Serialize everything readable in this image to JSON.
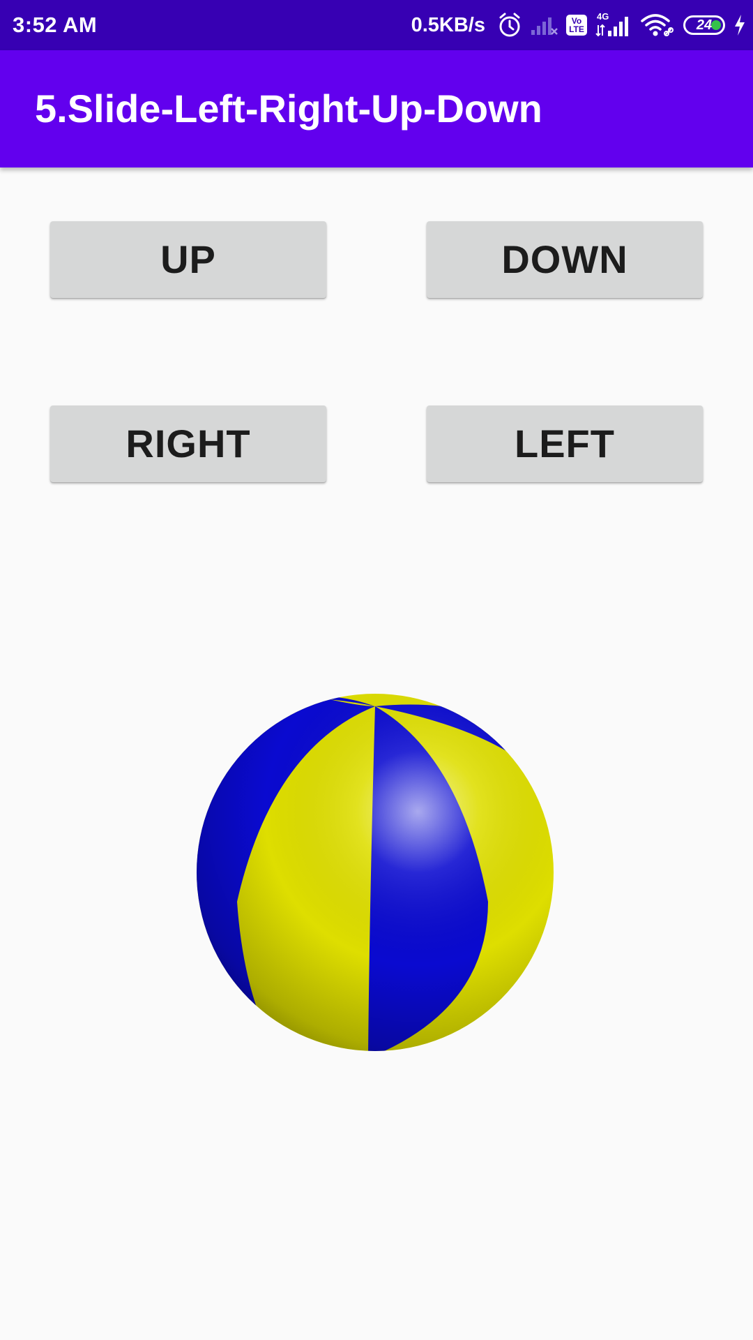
{
  "status_bar": {
    "time": "3:52 AM",
    "net_speed": "0.5KB/s",
    "volte_label_top": "Vo",
    "volte_label_bottom": "LTE",
    "network_type": "4G",
    "battery_level": "24",
    "icons": [
      "alarm-icon",
      "signal-x-icon",
      "volte-icon",
      "signal-icon",
      "wifi-icon",
      "battery-icon",
      "charging-icon"
    ]
  },
  "app_bar": {
    "title": "5.Slide-Left-Right-Up-Down"
  },
  "buttons": {
    "up": "UP",
    "down": "DOWN",
    "right": "RIGHT",
    "left": "LEFT"
  },
  "colors": {
    "status_bar": "#3700b3",
    "app_bar": "#6200ee",
    "button_bg": "#d6d7d7",
    "ball_blue": "#0a0ad0",
    "ball_yellow": "#dede00"
  }
}
